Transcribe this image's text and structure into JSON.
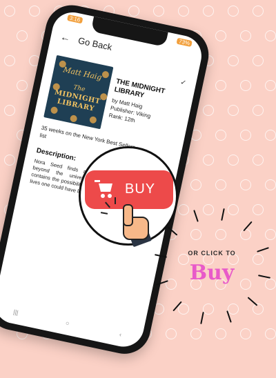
{
  "status_bar": {
    "time": "3:16",
    "battery": "73%"
  },
  "app_bar": {
    "back_icon": "arrow-left-icon",
    "back_label": "Go Back"
  },
  "book": {
    "cover": {
      "author": "Matt Haig",
      "title_line1": "The",
      "title_line2": "MIDNIGHT",
      "title_line3": "LIBRARY"
    },
    "title": "THE MIDNIGHT LIBRARY",
    "author_line": "by Matt Haig",
    "publisher_line": "Publisher: Viking",
    "rank_line": "Rank: 12th",
    "weeks_on_list": "35 weeks on the New York Best Sellers list",
    "description_heading": "Description:",
    "description": "Nora Seed finds a library beyond the universe that contains the possibilities of the lives one could have lived."
  },
  "buy_button": {
    "label": "BUY",
    "icon": "shopping-cart-icon"
  },
  "cta": {
    "small": "OR CLICK TO",
    "big": "Buy"
  },
  "colors": {
    "background": "#fbd1c6",
    "buy_button": "#ed4a4a",
    "cta_big": "#e85ac9"
  }
}
